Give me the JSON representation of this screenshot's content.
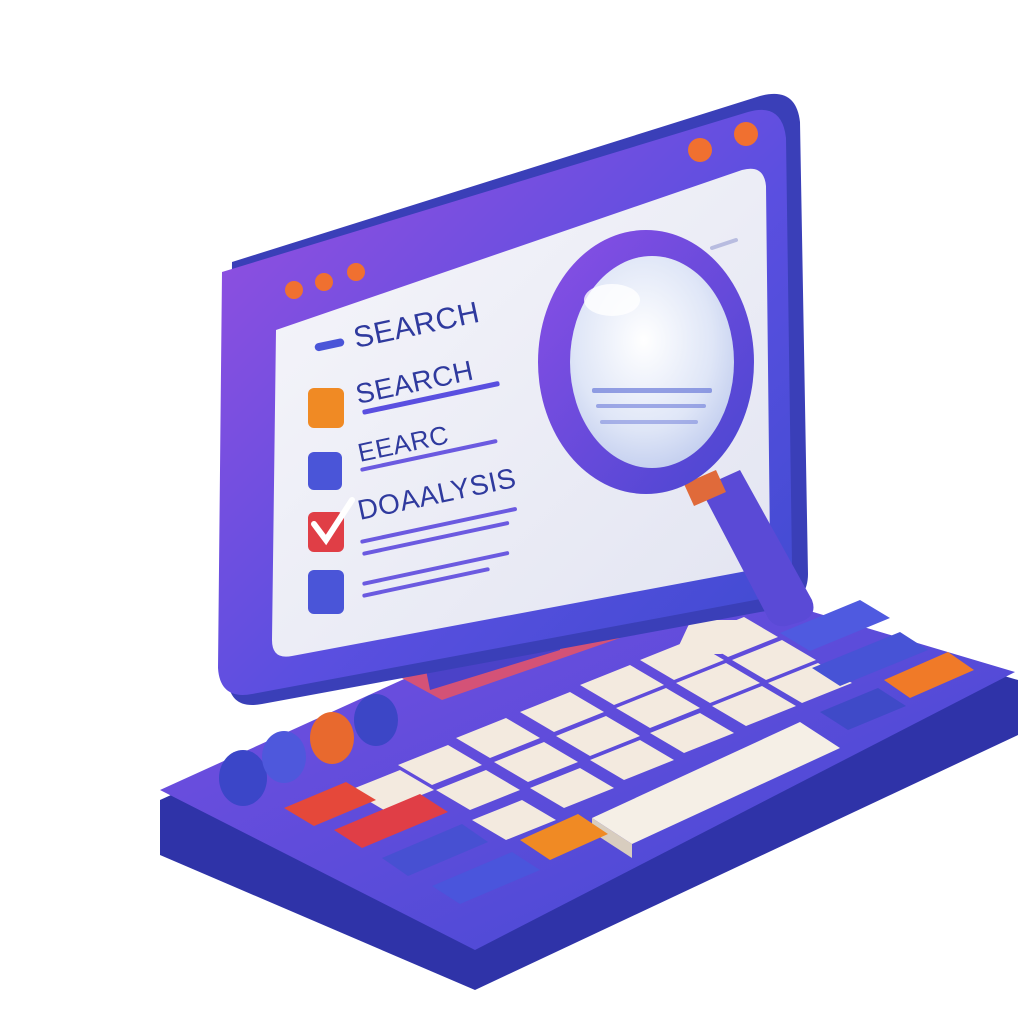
{
  "screen": {
    "items": [
      {
        "label": "SEARCH"
      },
      {
        "label": "SEARCH"
      },
      {
        "label": "EEARC"
      },
      {
        "label": "DOAALYSIS"
      }
    ]
  },
  "colors": {
    "purple": "#6b3fd6",
    "blue": "#4a55d8",
    "orange": "#f08a24",
    "red": "#e23c3c",
    "cream": "#f3eadf",
    "screen": "#eceef6"
  }
}
